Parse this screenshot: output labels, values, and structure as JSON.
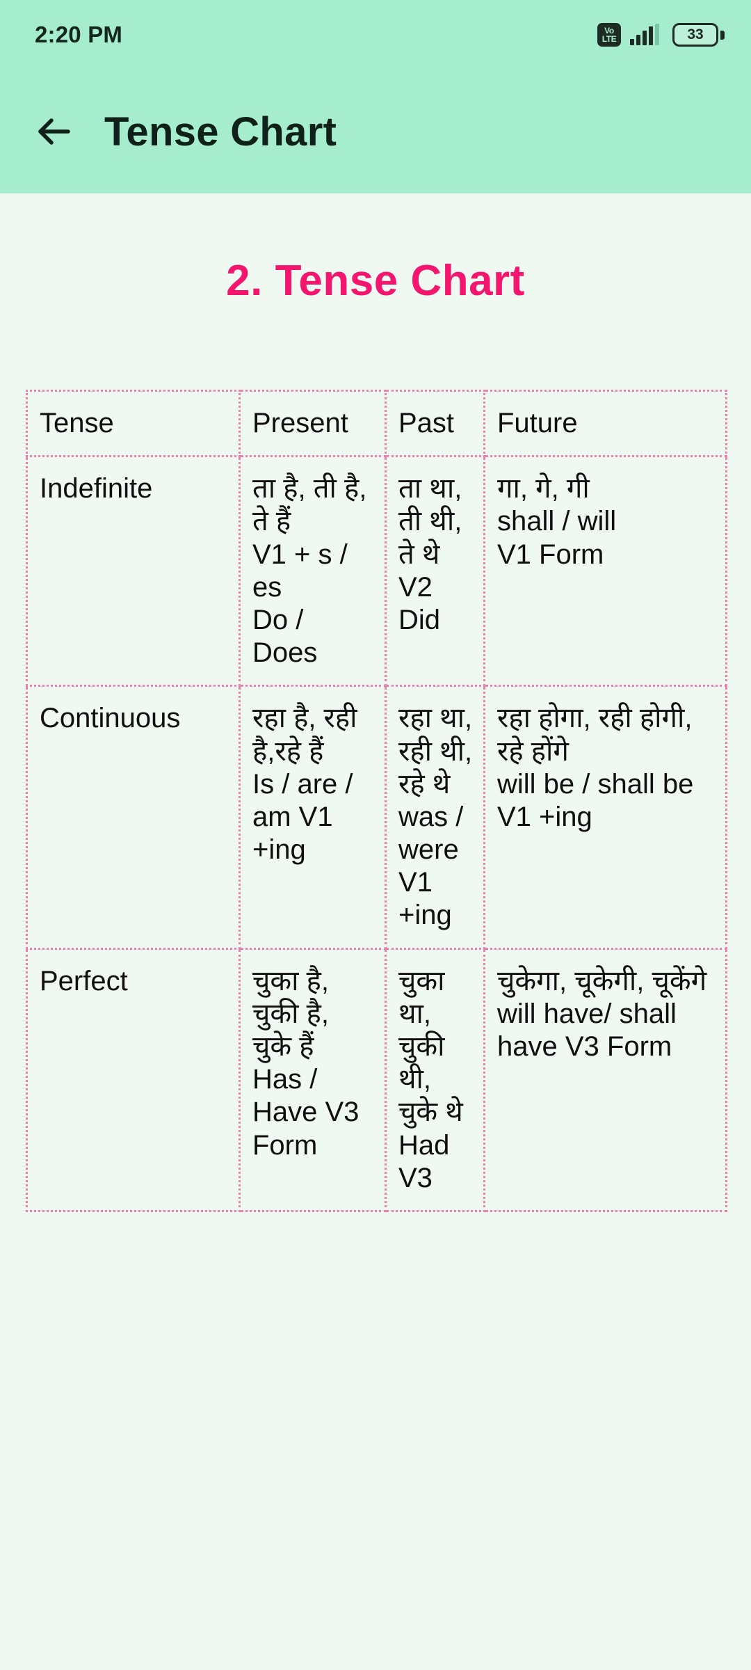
{
  "status_bar": {
    "clock": "2:20 PM",
    "network_badge_top": "Vo",
    "network_badge_bottom": "LTE",
    "battery_level": "33",
    "signal_icon": "signal-bars-icon",
    "battery_icon": "battery-icon"
  },
  "app_bar": {
    "back_icon": "back-arrow-icon",
    "title": "Tense Chart"
  },
  "page": {
    "heading": "2. Tense Chart",
    "heading_color": "#f4166e",
    "background_color": "#eff9f2",
    "appbar_color": "#a6edcd"
  },
  "chart_data": {
    "type": "table",
    "title": "2. Tense Chart",
    "border_color": "#ef7fad",
    "header_label_color": "#8f00e8",
    "header_period_color": "#d4772a",
    "row_label_color": "#3f8a3a",
    "columns": [
      "Tense",
      "Present",
      "Past",
      "Future"
    ],
    "rows": [
      {
        "label": "Indefinite",
        "present": [
          "ता है, ती है, ते हैं",
          "V1 + s / es",
          "Do / Does"
        ],
        "past": [
          "ता था, ती थी, ते थे",
          "V2",
          "Did"
        ],
        "future": [
          "गा, गे, गी",
          "shall / will",
          "V1 Form"
        ]
      },
      {
        "label": "Continuous",
        "present": [
          "रहा है, रही है,रहे हैं",
          "Is / are / am V1 +ing"
        ],
        "past": [
          "रहा था, रही थी, रहे थे",
          "was / were V1 +ing"
        ],
        "future": [
          "रहा होगा, रही होगी, रहे होंगे",
          "will be / shall be V1 +ing"
        ]
      },
      {
        "label": "Perfect",
        "present": [
          "चुका है, चुकी है, चुके हैं",
          "Has / Have V3 Form"
        ],
        "past": [
          "चुका था, चुकी थी, चुके थे",
          " Had V3"
        ],
        "future": [
          "चुकेगा, चूकेगी, चूकेंगे",
          "will have/ shall have V3 Form"
        ]
      }
    ]
  }
}
